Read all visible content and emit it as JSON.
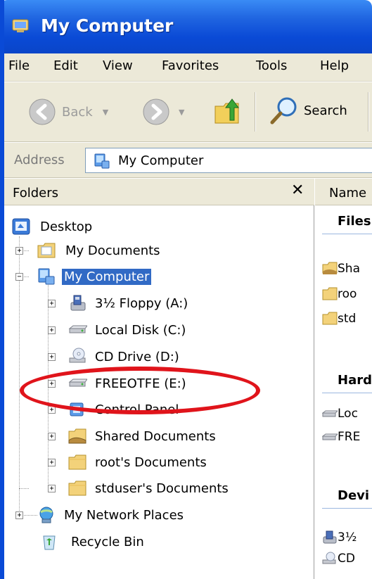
{
  "window": {
    "title": "My Computer"
  },
  "menubar": {
    "items": [
      "File",
      "Edit",
      "View",
      "Favorites",
      "Tools",
      "Help"
    ]
  },
  "toolbar": {
    "back_label": "Back",
    "search_label": "Search"
  },
  "address": {
    "label": "Address",
    "value": "My Computer"
  },
  "folders_pane": {
    "title": "Folders",
    "close_glyph": "✕",
    "tree": [
      {
        "label": "Desktop"
      },
      {
        "label": "My Documents",
        "expander": "+"
      },
      {
        "label": "My Computer",
        "expander": "−",
        "selected": true
      },
      {
        "label": "3½ Floppy (A:)",
        "expander": "+"
      },
      {
        "label": "Local Disk (C:)",
        "expander": "+"
      },
      {
        "label": "CD Drive (D:)",
        "expander": "+"
      },
      {
        "label": "FREEOTFE (E:)",
        "expander": "+"
      },
      {
        "label": "Control Panel",
        "expander": "+"
      },
      {
        "label": "Shared Documents",
        "expander": "+"
      },
      {
        "label": "root's Documents",
        "expander": "+"
      },
      {
        "label": "stduser's Documents",
        "expander": "+"
      },
      {
        "label": "My Network Places",
        "expander": "+"
      },
      {
        "label": "Recycle Bin"
      }
    ]
  },
  "right_pane": {
    "column_name": "Name",
    "groups": [
      {
        "heading": "Files",
        "items": [
          "Sha",
          "roo",
          "std"
        ]
      },
      {
        "heading": "Hard",
        "items": [
          "Loc",
          "FRE"
        ]
      },
      {
        "heading": "Devi",
        "items": [
          "3½",
          "CD"
        ]
      }
    ]
  },
  "colors": {
    "titlebar": "#0a4ad6",
    "selection": "#316ac5",
    "highlight_ring": "#e0141b"
  }
}
